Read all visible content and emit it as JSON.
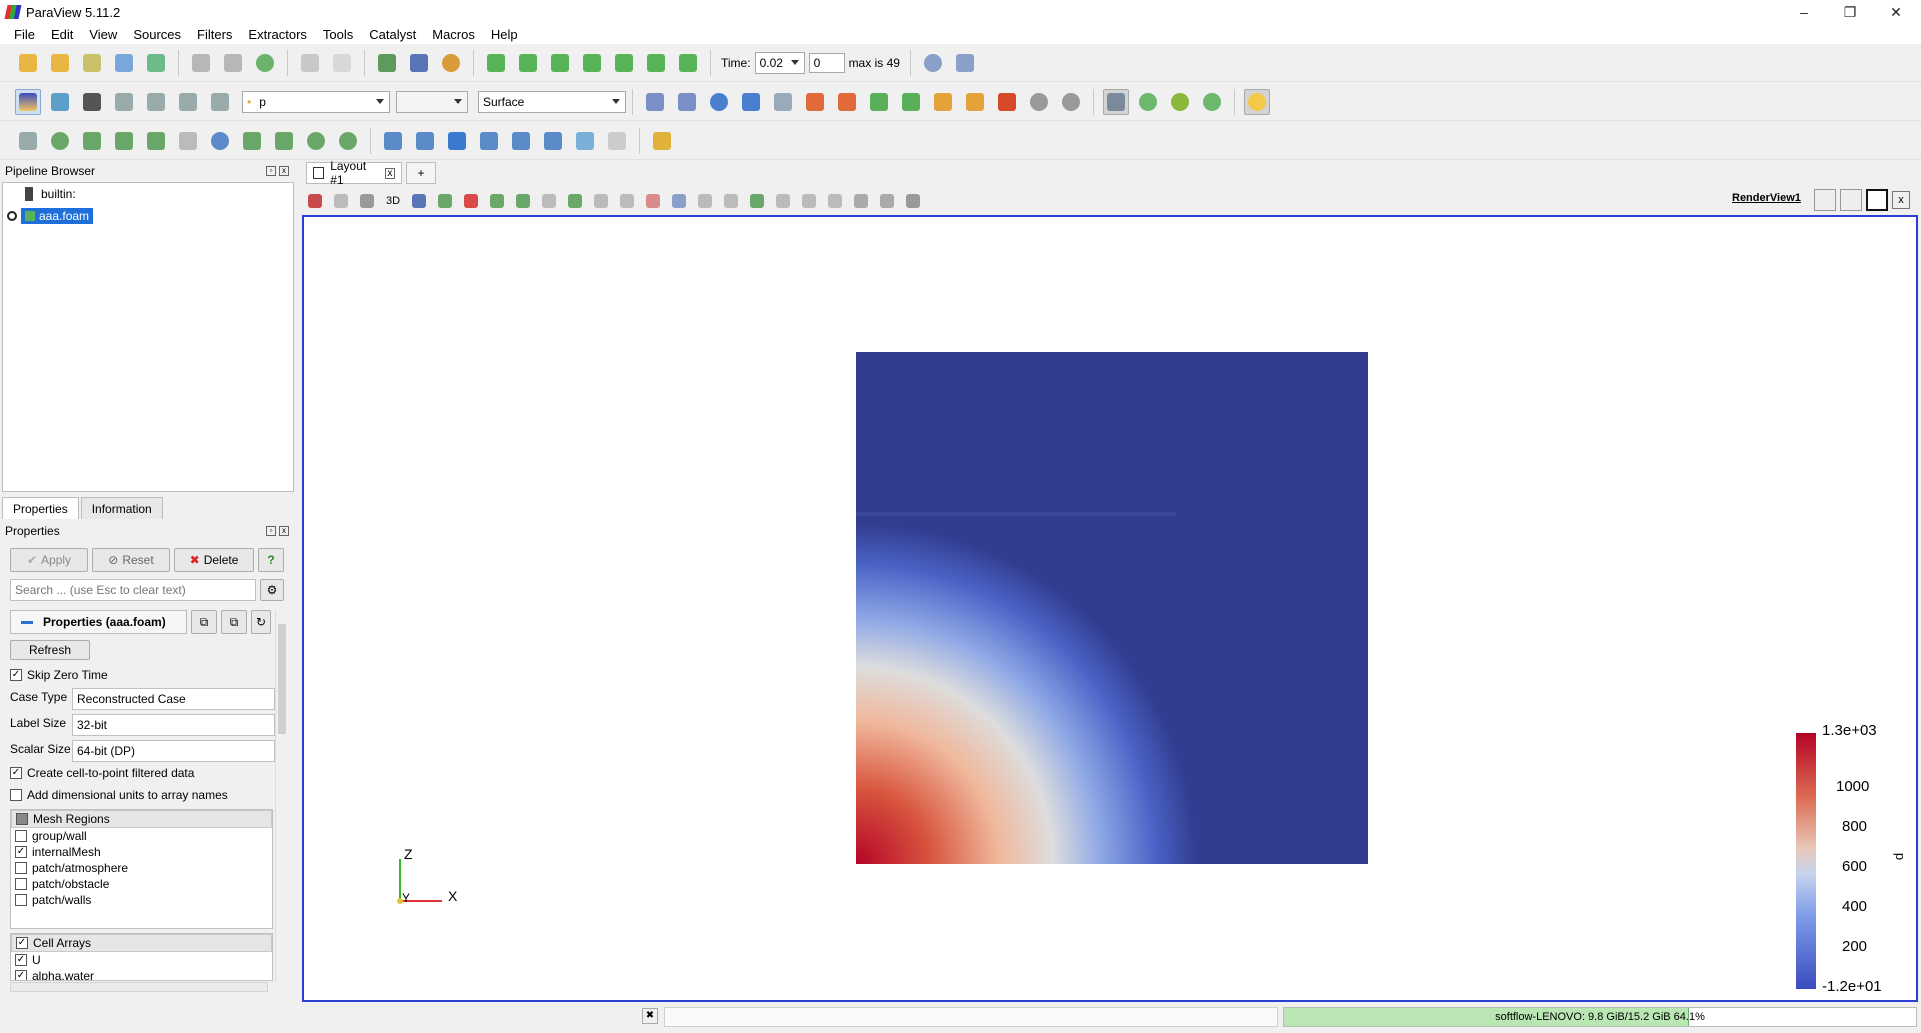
{
  "window": {
    "title": "ParaView 5.11.2",
    "controls": [
      "–",
      "❐",
      "✕"
    ]
  },
  "menu": [
    "File",
    "Edit",
    "View",
    "Sources",
    "Filters",
    "Extractors",
    "Tools",
    "Catalyst",
    "Macros",
    "Help"
  ],
  "time_toolbar": {
    "time_label": "Time:",
    "time_value": "0.02",
    "index_value": "0",
    "max_label": "max is 49"
  },
  "variable_toolbar": {
    "array_value": "p",
    "component_value": "",
    "representation_value": "Surface"
  },
  "pipeline_browser": {
    "title": "Pipeline Browser",
    "items": [
      "builtin:",
      "aaa.foam"
    ]
  },
  "panel_tabs": {
    "properties": "Properties",
    "information": "Information"
  },
  "properties": {
    "title": "Properties",
    "apply": "Apply",
    "reset": "Reset",
    "delete": "Delete",
    "help": "?",
    "search_placeholder": "Search ... (use Esc to clear text)",
    "section_title": "Properties (aaa.foam)",
    "refresh": "Refresh",
    "skip_zero_time": "Skip Zero Time",
    "case_type_label": "Case Type",
    "case_type_value": "Reconstructed Case",
    "label_size_label": "Label Size",
    "label_size_value": "32-bit",
    "scalar_size_label": "Scalar Size",
    "scalar_size_value": "64-bit (DP)",
    "create_cell_to_point": "Create cell-to-point filtered data",
    "add_dimensional_units": "Add dimensional units to array names",
    "mesh_regions_header": "Mesh Regions",
    "mesh_regions": [
      {
        "label": "group/wall",
        "checked": false
      },
      {
        "label": "internalMesh",
        "checked": true
      },
      {
        "label": "patch/atmosphere",
        "checked": false
      },
      {
        "label": "patch/obstacle",
        "checked": false
      },
      {
        "label": "patch/walls",
        "checked": false
      }
    ],
    "cell_arrays_header": "Cell Arrays",
    "cell_arrays": [
      {
        "label": "U",
        "checked": true
      },
      {
        "label": "alpha.water",
        "checked": true
      }
    ]
  },
  "view": {
    "layout_tab": "Layout #1",
    "add_tab": "+",
    "toolbar_3d": "3D",
    "render_view_label": "RenderView1",
    "axes": {
      "z": "Z",
      "y": "Y",
      "x": "X"
    },
    "legend": {
      "title": "p",
      "ticks": [
        "1.3e+03",
        "1000",
        "800",
        "600",
        "400",
        "200",
        "-1.2e+01"
      ],
      "colors": {
        "high": "#b40426",
        "mid": "#dddddd",
        "low": "#3b4cc0"
      }
    }
  },
  "status": {
    "memory": "softflow-LENOVO: 9.8 GiB/15.2 GiB 64.1%",
    "memory_fraction": 0.641
  }
}
